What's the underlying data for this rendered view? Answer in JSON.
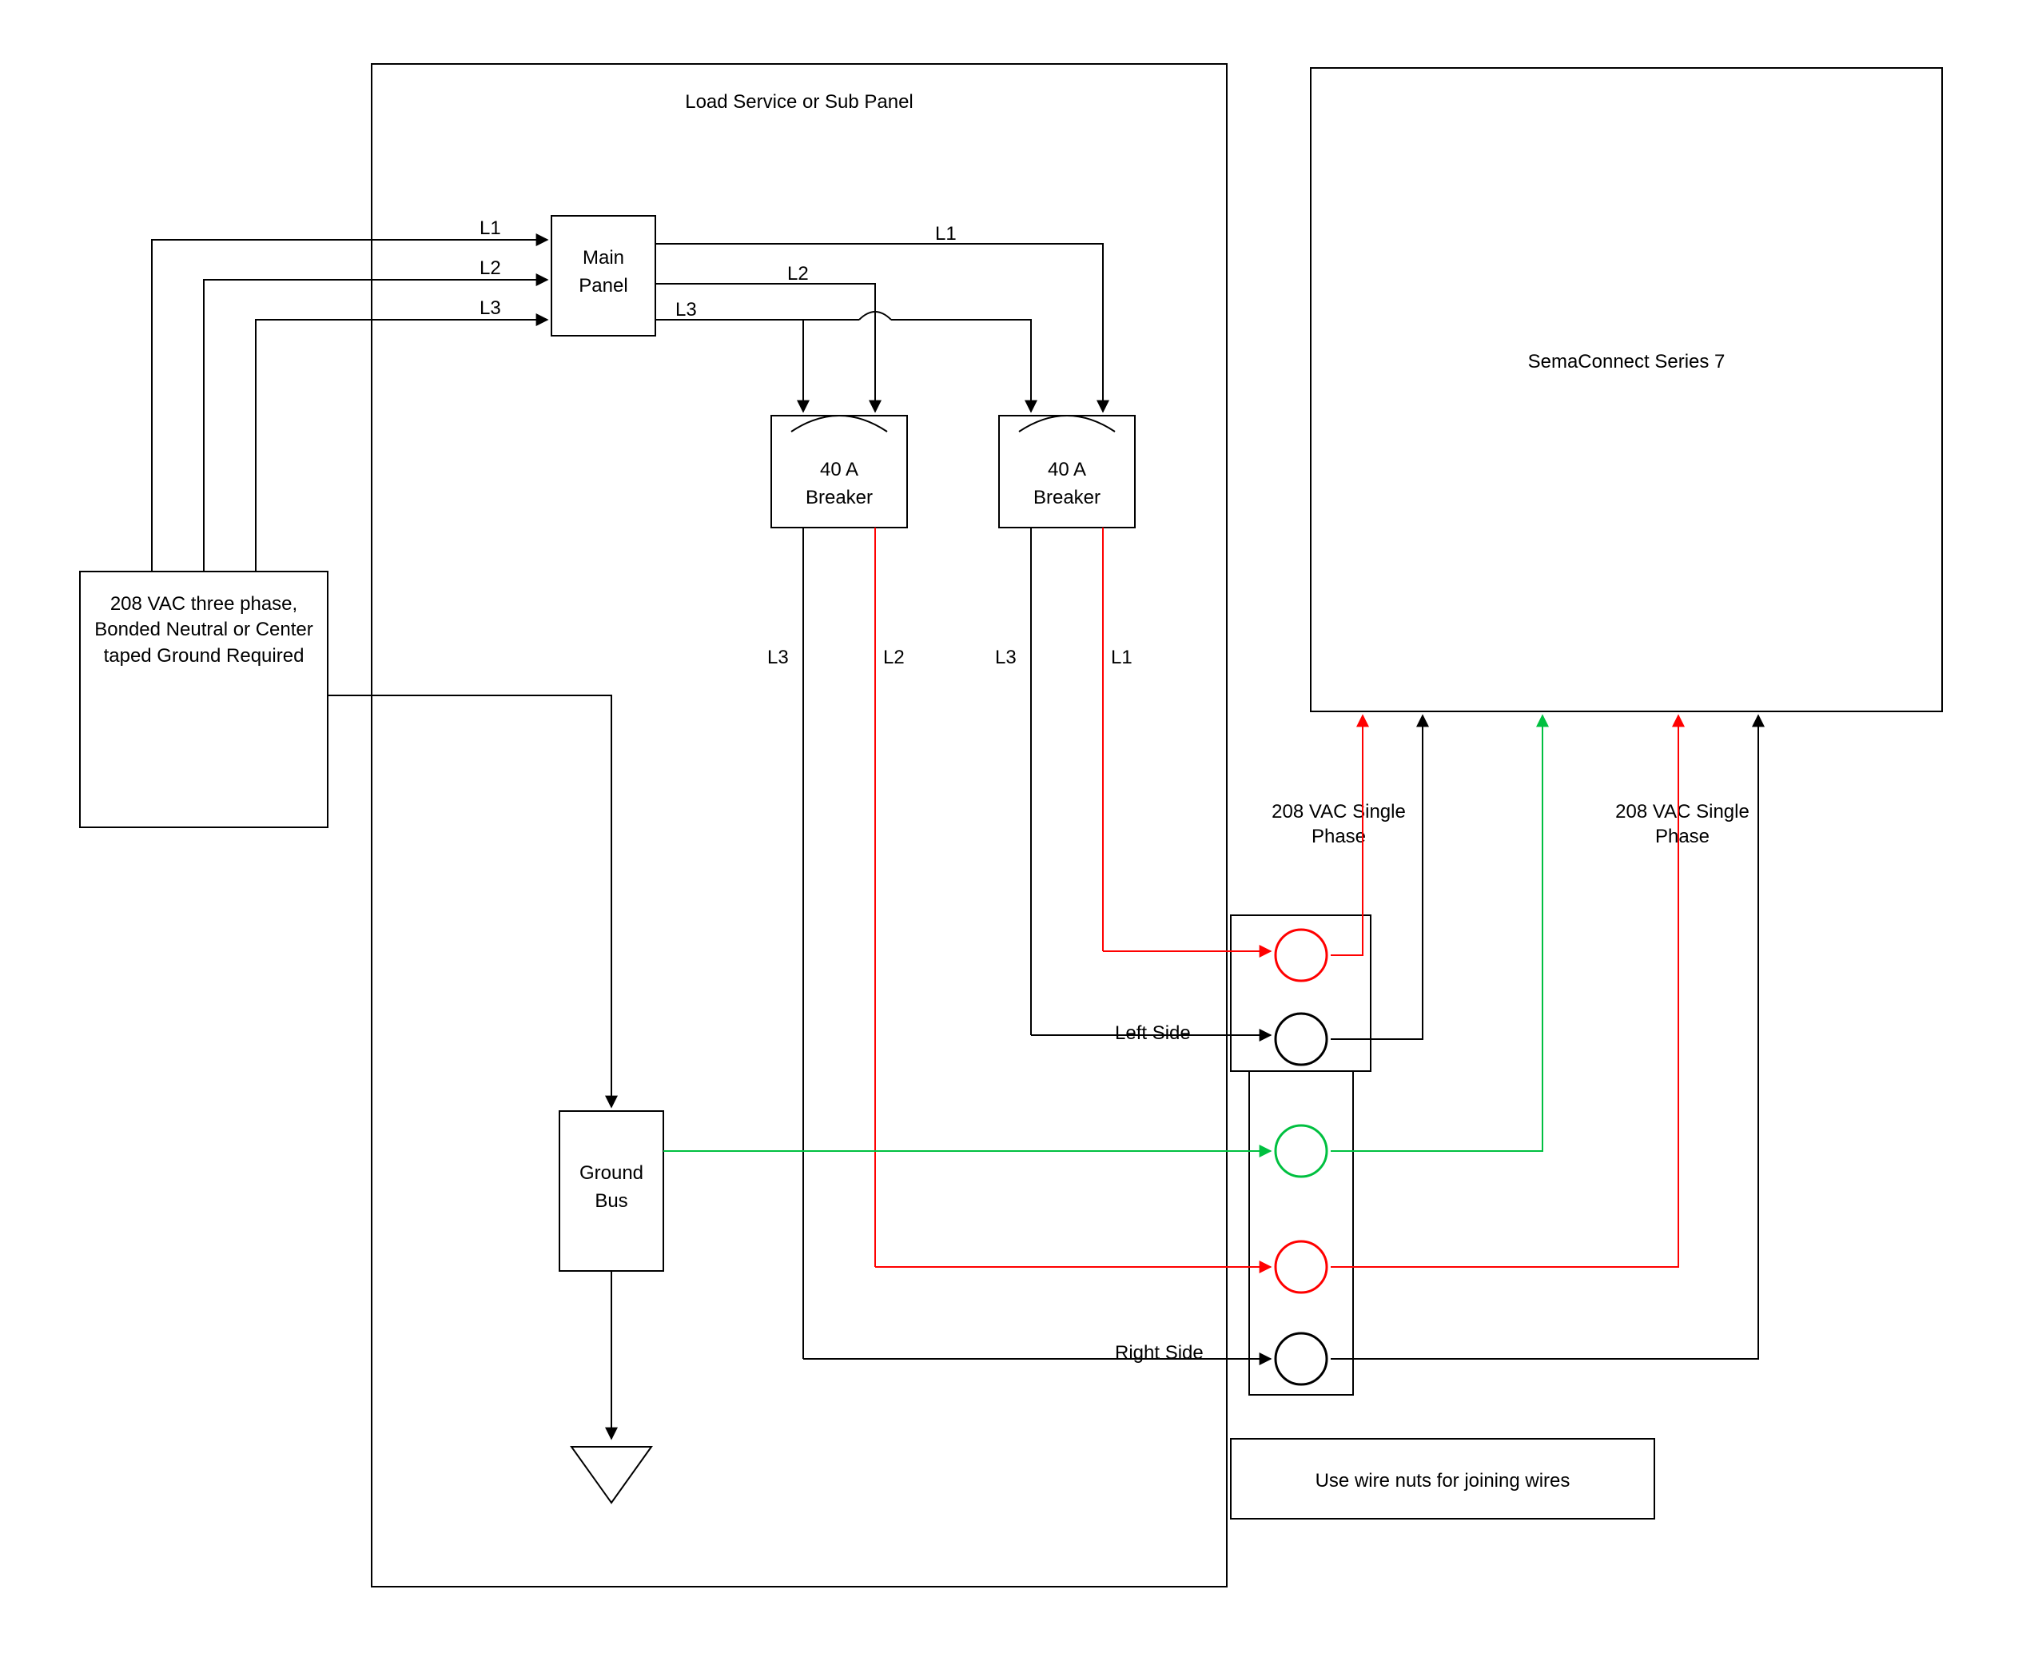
{
  "panel": {
    "title": "Load Service or Sub Panel",
    "source_box": "208 VAC three phase, Bonded Neutral or Center taped Ground Required",
    "main_panel": "Main Panel",
    "breaker1": "40 A Breaker",
    "breaker2": "40 A Breaker",
    "ground_bus": "Ground Bus",
    "lines": {
      "L1": "L1",
      "L2": "L2",
      "L3": "L3"
    }
  },
  "junction": {
    "left_side": "Left Side",
    "right_side": "Right Side",
    "note": "Use wire nuts for joining wires"
  },
  "device": {
    "name": "SemaConnect Series 7",
    "phase1": "208 VAC Single Phase",
    "phase2": "208 VAC Single Phase"
  },
  "colors": {
    "red": "#ff0000",
    "green": "#00c040",
    "black": "#000000"
  }
}
